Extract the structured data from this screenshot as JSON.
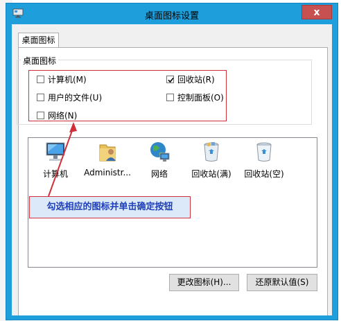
{
  "dialog": {
    "title": "桌面图标设置",
    "close_glyph": "x"
  },
  "tabs": [
    {
      "label": "桌面图标"
    }
  ],
  "group": {
    "legend": "桌面图标",
    "checkboxes": [
      {
        "label": "计算机(M)",
        "checked": false
      },
      {
        "label": "回收站(R)",
        "checked": true
      },
      {
        "label": "用户的文件(U)",
        "checked": false
      },
      {
        "label": "控制面板(O)",
        "checked": false
      },
      {
        "label": "网络(N)",
        "checked": false
      }
    ]
  },
  "icons": [
    {
      "label": "计算机",
      "icon": "computer-icon"
    },
    {
      "label": "Administr...",
      "icon": "user-folder-icon"
    },
    {
      "label": "网络",
      "icon": "network-icon"
    },
    {
      "label": "回收站(满)",
      "icon": "recycle-bin-full-icon"
    },
    {
      "label": "回收站(空)",
      "icon": "recycle-bin-empty-icon"
    }
  ],
  "annotation": {
    "text": "勾选相应的图标并单击确定按钮"
  },
  "buttons": {
    "change_icon": "更改图标(H)...",
    "restore_default": "还原默认值(S)"
  },
  "colors": {
    "titlebar": "#1e9fdc",
    "close": "#c75050",
    "highlight_border": "#d0303a",
    "annotation_text": "#1f3fb8",
    "annotation_bg": "#dbe9f8"
  }
}
